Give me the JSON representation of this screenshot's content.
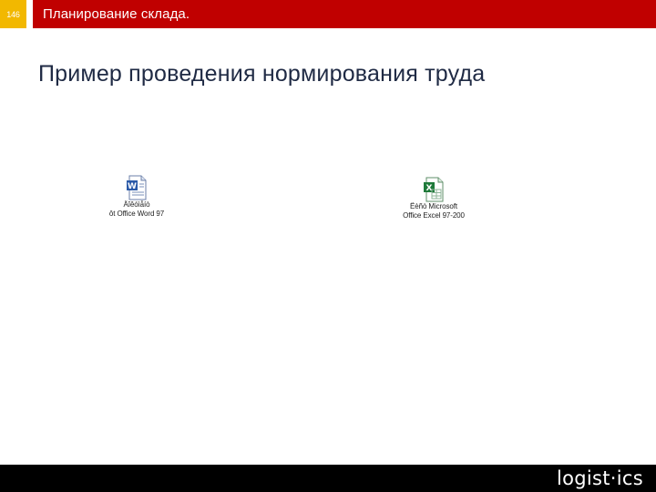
{
  "header": {
    "slide_number": "146",
    "title": "Планирование склада."
  },
  "slide": {
    "title": "Пример проведения нормирования труда"
  },
  "embedded_objects": [
    {
      "icon": "word-document-icon",
      "caption_line1": "Äîêóìåíò",
      "caption_line2": "ôt Office Word 97"
    },
    {
      "icon": "excel-sheet-icon",
      "caption_line1": "Ëèñò Microsoft",
      "caption_line2": "Office Excel 97-200"
    }
  ],
  "footer": {
    "logo_text": "logist·ics"
  },
  "colors": {
    "header_red": "#c00000",
    "slide_number_yellow": "#f2b800",
    "footer_black": "#000000",
    "title_text": "#1f2a44"
  }
}
